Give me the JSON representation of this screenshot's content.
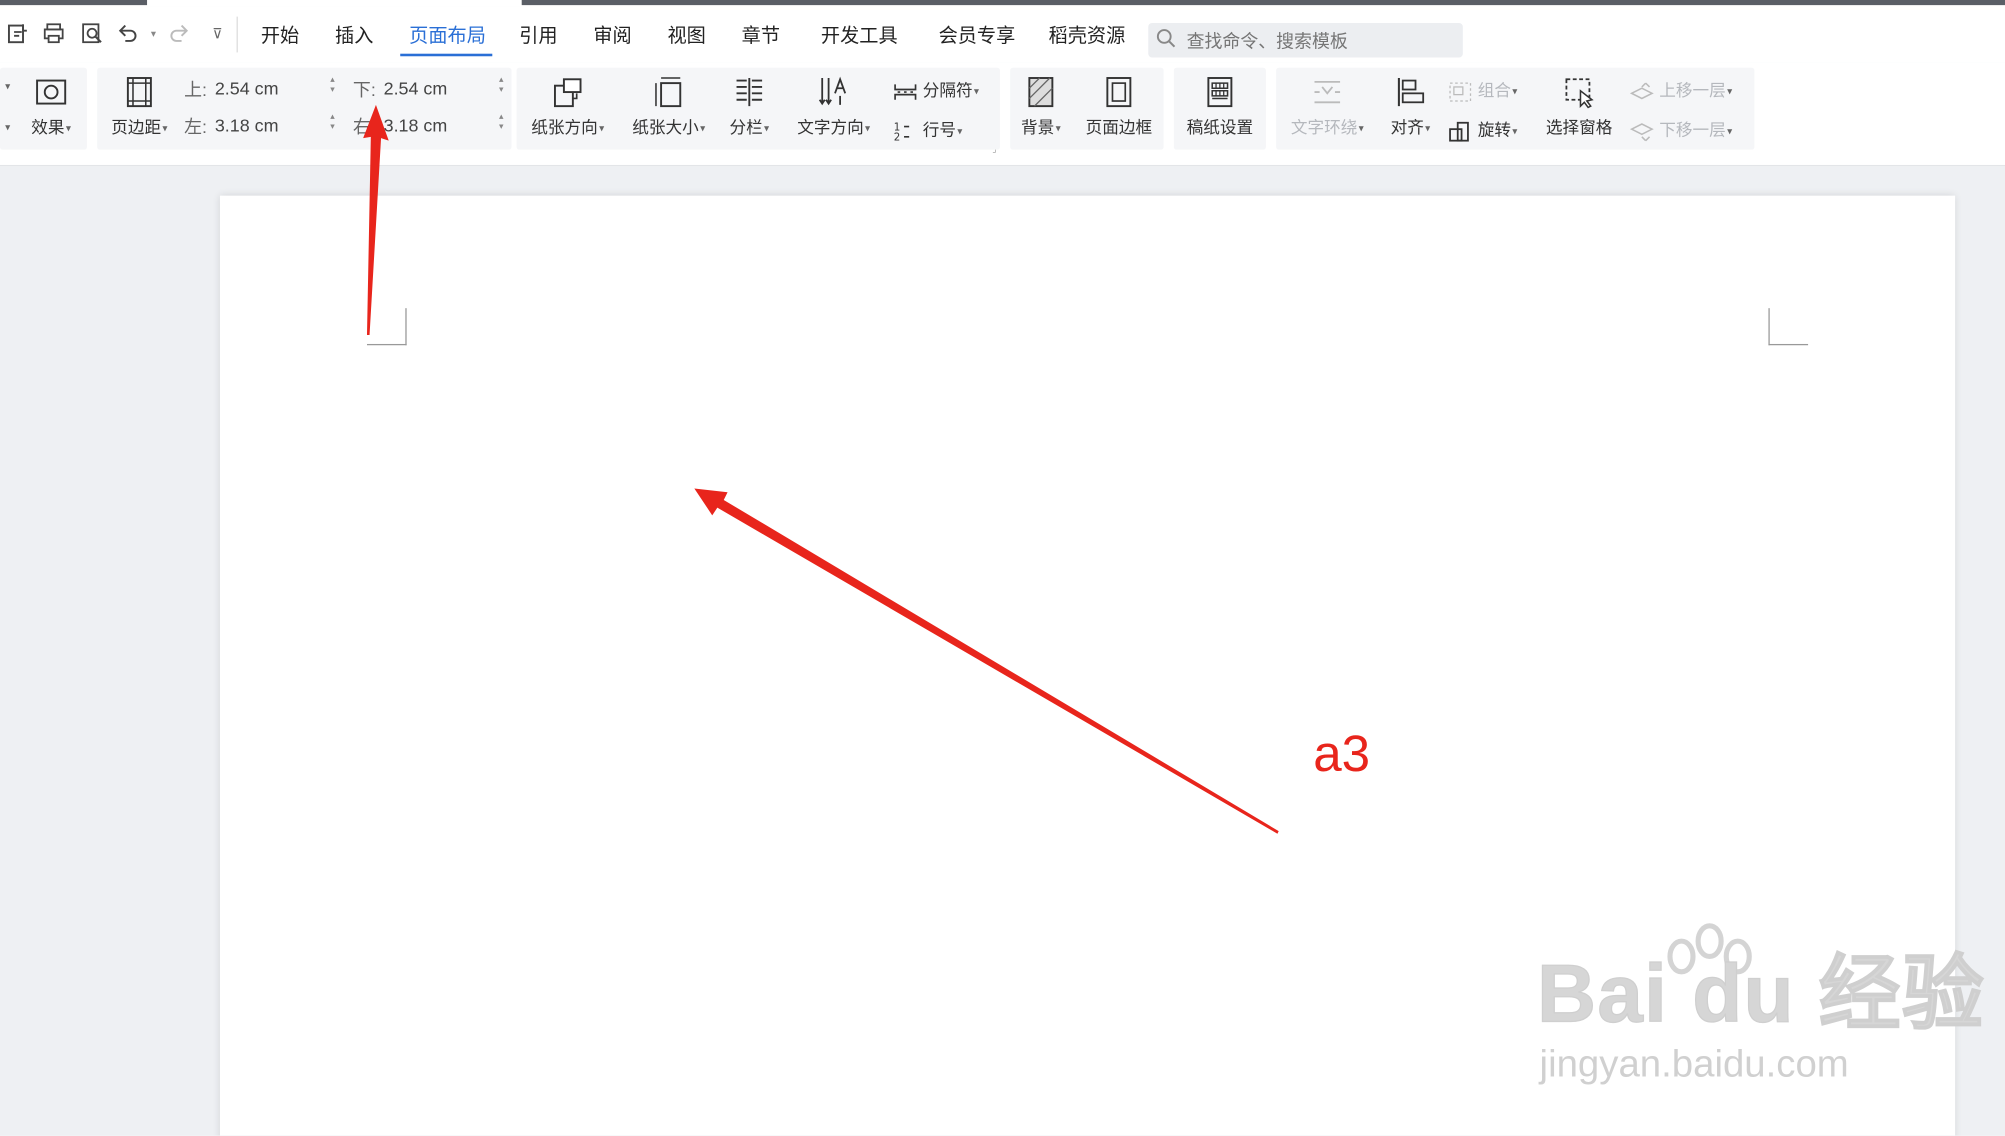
{
  "menu": {
    "tabs": [
      "开始",
      "插入",
      "页面布局",
      "引用",
      "审阅",
      "视图",
      "章节",
      "开发工具",
      "会员专享",
      "稻壳资源"
    ],
    "active_tab": "页面布局",
    "search_placeholder": "查找命令、搜索模板"
  },
  "ribbon": {
    "effect_label": "效果",
    "margins_label": "页边距",
    "margin_top_label": "上:",
    "margin_top_value": "2.54 cm",
    "margin_bottom_label": "下:",
    "margin_bottom_value": "2.54 cm",
    "margin_left_label": "左:",
    "margin_left_value": "3.18 cm",
    "margin_right_label": "右:",
    "margin_right_value": "3.18 cm",
    "orientation_label": "纸张方向",
    "size_label": "纸张大小",
    "columns_label": "分栏",
    "text_direction_label": "文字方向",
    "breaks_label": "分隔符",
    "line_numbers_label": "行号",
    "background_label": "背景",
    "page_border_label": "页面边框",
    "manuscript_label": "稿纸设置",
    "wrap_text_label": "文字环绕",
    "align_label": "对齐",
    "group_label": "组合",
    "rotate_label": "旋转",
    "selection_pane_label": "选择窗格",
    "bring_forward_label": "上移一层",
    "send_backward_label": "下移一层"
  },
  "annotation": {
    "label": "a3",
    "color": "#e8251c"
  },
  "watermark": {
    "logo_text": "Bai du 经验",
    "url_text": "jingyan.baidu.com"
  },
  "colors": {
    "accent": "#2a6fd6",
    "arrow": "#e8251c"
  },
  "icons": [
    "quick-access-icons",
    "undo-icon",
    "redo-icon",
    "search-icon",
    "effect-icon",
    "margins-icon",
    "orientation-icon",
    "size-icon",
    "columns-icon",
    "text-direction-icon",
    "breaks-icon",
    "line-numbers-icon",
    "background-icon",
    "page-border-icon",
    "manuscript-icon",
    "wrap-icon",
    "align-icon",
    "group-icon",
    "rotate-icon",
    "selection-pane-icon",
    "bring-forward-icon",
    "send-backward-icon"
  ]
}
